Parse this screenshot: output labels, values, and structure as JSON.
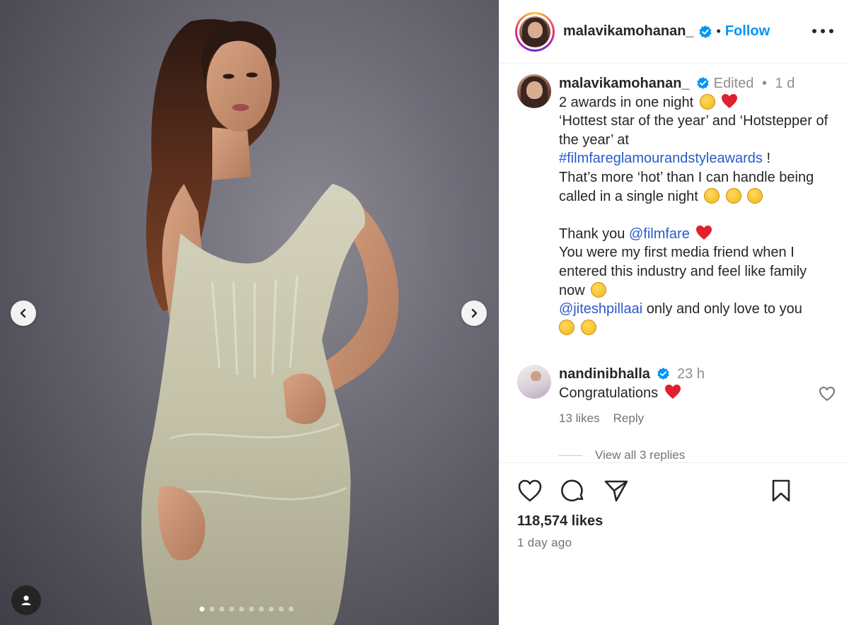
{
  "post": {
    "author": "malavikamohanan_",
    "follow_label": "Follow",
    "bullet": "•",
    "media": {
      "carousel_count": 10,
      "active_index": 0
    }
  },
  "caption": {
    "username": "malavikamohanan_",
    "edited": "Edited",
    "bullet": "•",
    "time": "1 d",
    "line1": "2 awards in one night",
    "line2": "‘Hottest star of the year’ and ‘Hotstepper of the year’ at",
    "hashtag": "#filmfareglamourandstyleawards",
    "hashtag_suffix": " !",
    "line3": "That’s more ‘hot’ than I can handle being called in a single night",
    "thank_prefix": "Thank you ",
    "mention1": "@filmfare",
    "line4": "You were my first media friend when I entered this industry and feel like family now",
    "mention2": "@jiteshpillaai",
    "line5": " only and only love to you"
  },
  "comment": {
    "username": "nandinibhalla",
    "time": "23 h",
    "text": "Congratulations",
    "likes": "13 likes",
    "reply_label": "Reply",
    "view_replies": "View all 3 replies"
  },
  "footer": {
    "likes": "118,574 likes",
    "posted": "1 day ago"
  },
  "icons": {
    "prev": "chevron-left-icon",
    "next": "chevron-right-icon",
    "tag": "user-tag-icon",
    "more": "more-options-icon",
    "verified": "verified-badge-icon",
    "like": "heart-icon",
    "comment": "comment-bubble-icon",
    "share": "paper-plane-icon",
    "save": "bookmark-icon"
  },
  "colors": {
    "accent": "#0095f6",
    "link": "#2a5ac8",
    "heart_red": "#ed4956",
    "muted": "#737373"
  }
}
